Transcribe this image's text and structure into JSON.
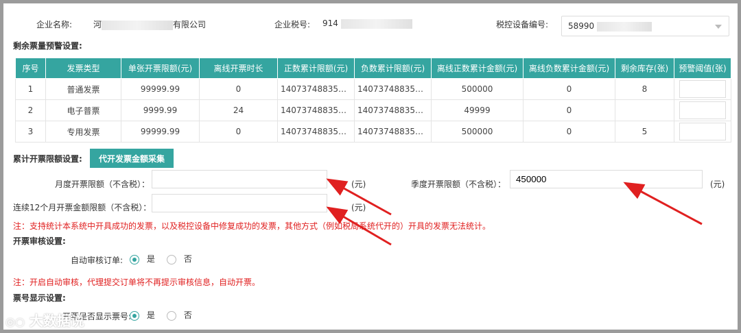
{
  "header": {
    "company_label": "企业名称:",
    "company_value_start": "河",
    "company_value_end": "有限公司",
    "tax_label": "企业税号:",
    "tax_value_start": "914",
    "device_label": "税控设备编号:",
    "device_value_start": "58990"
  },
  "remaining_section": {
    "title": "剩余票量预警设置:"
  },
  "table": {
    "headers": [
      "序号",
      "发票类型",
      "单张开票限额(元)",
      "离线开票时长",
      "正数累计限额(元)",
      "负数累计限额(元)",
      "离线正数累计金额(元)",
      "离线负数累计金额(元)",
      "剩余库存(张)",
      "预警阈值(张)"
    ],
    "rows": [
      {
        "no": "1",
        "type": "普通发票",
        "single_limit": "99999.99",
        "offline_duration": "0",
        "pos_limit": "1407374883553…",
        "neg_limit": "1407374883553…",
        "offline_pos": "500000",
        "offline_neg": "0",
        "stock": "8"
      },
      {
        "no": "2",
        "type": "电子普票",
        "single_limit": "9999.99",
        "offline_duration": "24",
        "pos_limit": "1407374883553…",
        "neg_limit": "1407374883553…",
        "offline_pos": "49999",
        "offline_neg": "0",
        "stock": ""
      },
      {
        "no": "3",
        "type": "专用发票",
        "single_limit": "99999.99",
        "offline_duration": "0",
        "pos_limit": "1407374883553…",
        "neg_limit": "1407374883553…",
        "offline_pos": "500000",
        "offline_neg": "0",
        "stock": "5"
      }
    ]
  },
  "cumulative": {
    "title": "累计开票限额设置:",
    "collect_button": "代开发票金额采集",
    "monthly_label": "月度开票限额（不含税）：",
    "monthly_value": "",
    "quarterly_label": "季度开票限额（不含税）：",
    "quarterly_value": "450000",
    "rolling_label": "连续12个月开票金额限额（不含税）：",
    "rolling_value": "",
    "unit": "(元)",
    "note": "注：支持统计本系统中开具成功的发票，以及税控设备中修复成功的发票，其他方式（例如税局系统代开的）开具的发票无法统计。"
  },
  "review": {
    "title": "开票审核设置:",
    "auto_label": "自动审核订单:",
    "yes": "是",
    "no": "否",
    "note": "注：开启自动审核，代理提交订单将不再提示审核信息，自动开票。"
  },
  "display": {
    "title": "票号显示设置:",
    "show_label": "开票是否显示票号:",
    "yes": "是",
    "no": "否"
  },
  "watermark": {
    "text": "大数据说"
  },
  "colors": {
    "accent": "#35a5a0",
    "note": "#e02020",
    "arrow": "#e02020"
  }
}
